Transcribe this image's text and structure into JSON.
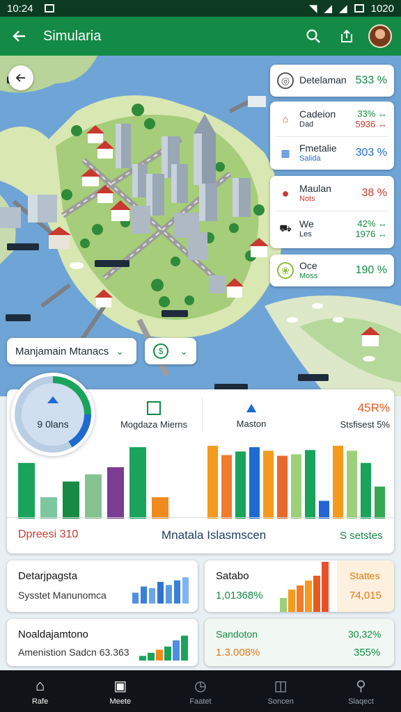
{
  "status_bar": {
    "time": "10:24",
    "battery": "1020"
  },
  "app_bar": {
    "title": "Simularia"
  },
  "map": {
    "labels": [
      "▬▬▬▬▬",
      "▬▬▬▬▬",
      "▬▬▬▬",
      "▬▬▬",
      "▬▬▬▬",
      "▬▬▬▬",
      "▬▬▬▬▬",
      "▬▬▬▬"
    ]
  },
  "stats": {
    "card1": {
      "label": "Detelaman",
      "value": "533 %"
    },
    "card2": [
      {
        "label": "Cadeion",
        "sublabel": "Dad",
        "value": "33% ↔",
        "value2": "5936 ↔"
      },
      {
        "label": "Fmetalie",
        "sublabel": "Salida",
        "value": "303 %"
      }
    ],
    "card3": [
      {
        "label": "Maulan",
        "sublabel": "Nots",
        "value": "38 %"
      },
      {
        "label": "We",
        "sublabel": "Les",
        "value": "42% ↔",
        "value2": "1976 ↔"
      }
    ],
    "card4": {
      "label": "Oce",
      "sublabel": "Moss",
      "value": "190 %"
    }
  },
  "dropdowns": {
    "district": "Manjamain Mtanacs"
  },
  "panel": {
    "gauge_label": "9 0lans",
    "tabs": [
      "Mogdaza Mierns",
      "Maston",
      "Stsfisest 5%"
    ],
    "tab3_top": "45R%",
    "footer_left": "Dpreesi 310",
    "footer_mid": "Mnatala Islasmscen",
    "footer_right": "S setstes"
  },
  "chart_data": {
    "type": "bar",
    "series": [
      {
        "values": [
          78,
          30,
          52,
          62,
          72,
          100,
          30
        ],
        "colors": [
          "#1aa35b",
          "#7cc6a0",
          "#198a44",
          "#86c28f",
          "#7b3d91",
          "#1aa35b",
          "#f08a1c"
        ]
      },
      {
        "values": [
          102,
          89,
          94,
          100,
          95,
          88,
          90,
          96,
          25,
          102,
          95,
          78,
          45
        ],
        "colors": [
          "#f59a1c",
          "#f07c2c",
          "#1aa35b",
          "#1e6bd0",
          "#f59a1c",
          "#e76a2a",
          "#9dd07a",
          "#1aa35b",
          "#2166d4",
          "#f59a1c",
          "#9dd07a",
          "#1aa35b",
          "#35a853"
        ]
      }
    ]
  },
  "bottom": {
    "c1": {
      "title": "Detarjpagsta",
      "sub": "Sysstet Manunomca",
      "bars": [
        14,
        22,
        20,
        28,
        24,
        30,
        34
      ]
    },
    "c2": {
      "title": "Satabo",
      "sub": "1,01368%",
      "right_title": "Stattes",
      "right_val": "74,015",
      "bars": [
        20,
        32,
        38,
        45,
        52,
        72
      ]
    },
    "c3": {
      "title": "Noaldajamtono",
      "sub": "Amenistion Sadcn 63.363",
      "bars": [
        6,
        10,
        14,
        18,
        26,
        32
      ]
    },
    "c4": {
      "title": "Sandoton",
      "sub": "1.3.008%",
      "right_title": "30,32%",
      "right_val": "355%"
    }
  },
  "nav": [
    "Rafe",
    "Meete",
    "Faatet",
    "Soncen",
    "Slaqect"
  ]
}
